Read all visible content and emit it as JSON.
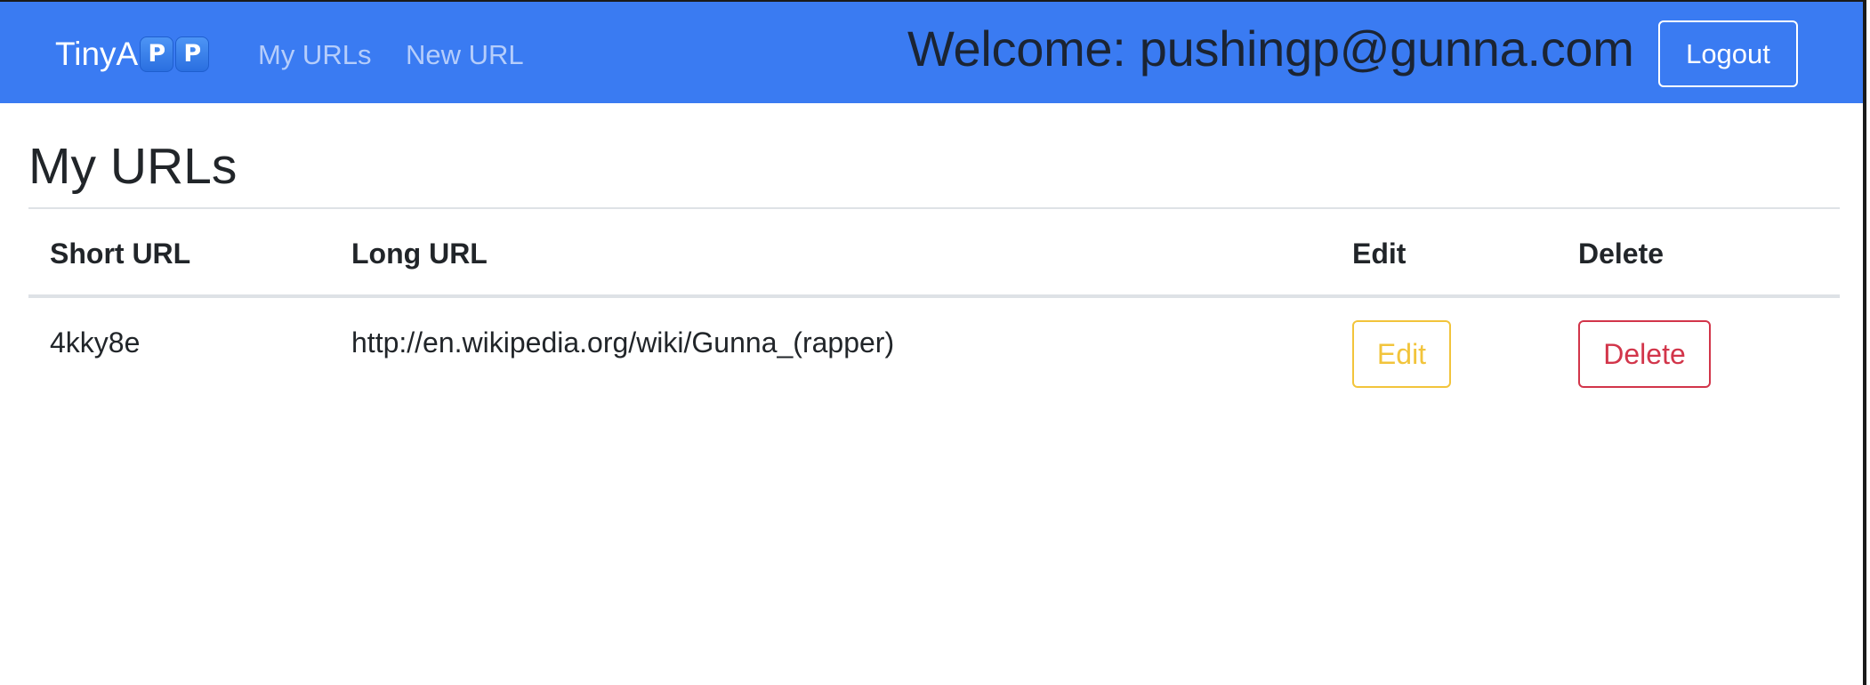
{
  "navbar": {
    "brand_text": "TinyA",
    "brand_badges": [
      "P",
      "P"
    ],
    "links": [
      {
        "label": "My URLs"
      },
      {
        "label": "New URL"
      }
    ],
    "welcome": "Welcome: pushingp@gunna.com",
    "logout_label": "Logout"
  },
  "main": {
    "title": "My URLs",
    "table": {
      "headers": [
        "Short URL",
        "Long URL",
        "Edit",
        "Delete"
      ],
      "rows": [
        {
          "short_url": "4kky8e",
          "long_url": "http://en.wikipedia.org/wiki/Gunna_(rapper)",
          "edit_label": "Edit",
          "delete_label": "Delete"
        }
      ]
    }
  },
  "colors": {
    "navbar_bg": "#3a7bf2",
    "edit_accent": "#f2c43b",
    "delete_accent": "#d2354a"
  }
}
